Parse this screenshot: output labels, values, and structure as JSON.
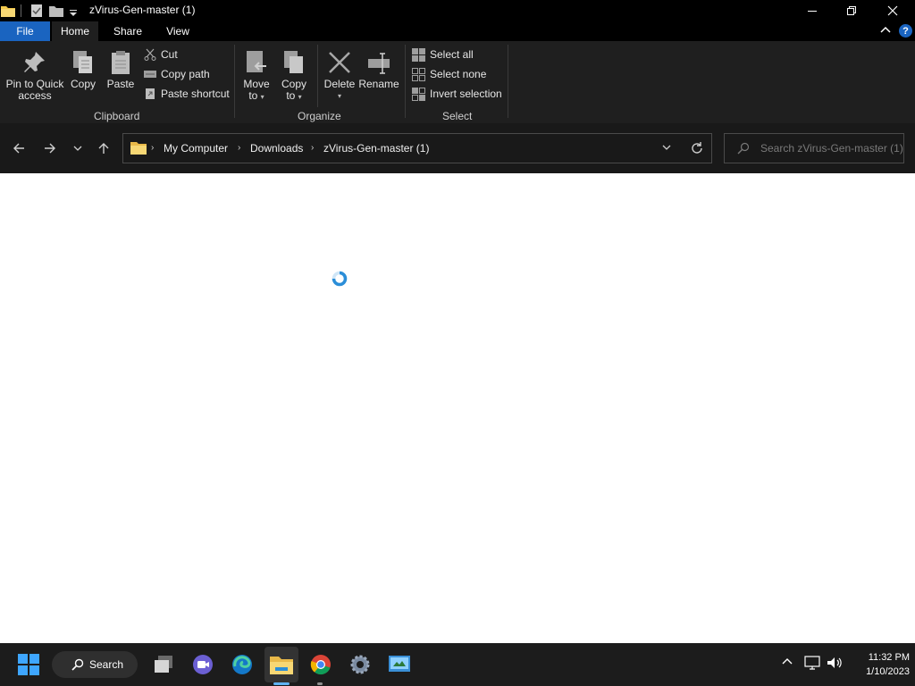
{
  "window": {
    "title": "zVirus-Gen-master (1)"
  },
  "ribbon": {
    "tabs": [
      {
        "label": "File",
        "active": false
      },
      {
        "label": "Home",
        "active": true
      },
      {
        "label": "Share",
        "active": false
      },
      {
        "label": "View",
        "active": false
      }
    ],
    "help_label": "?",
    "clipboard": {
      "pin_line1": "Pin to Quick",
      "pin_line2": "access",
      "copy": "Copy",
      "paste": "Paste",
      "cut": "Cut",
      "copy_path": "Copy path",
      "paste_shortcut": "Paste shortcut",
      "group_label": "Clipboard"
    },
    "organize": {
      "move_line1": "Move",
      "move_line2": "to",
      "copy_line1": "Copy",
      "copy_line2": "to",
      "delete": "Delete",
      "rename": "Rename",
      "group_label": "Organize"
    },
    "select": {
      "select_all": "Select all",
      "select_none": "Select none",
      "invert_selection": "Invert selection",
      "group_label": "Select"
    }
  },
  "address": {
    "breadcrumb": [
      "My Computer",
      "Downloads",
      "zVirus-Gen-master (1)"
    ]
  },
  "search": {
    "placeholder": "Search zVirus-Gen-master (1)"
  },
  "content": {
    "state": "loading"
  },
  "taskbar": {
    "search_label": "Search",
    "pinned": [
      "start-icon",
      "task-view-icon",
      "teams-chat-icon",
      "edge-icon",
      "file-explorer-icon",
      "chrome-icon",
      "settings-icon",
      "control-panel-icon"
    ],
    "clock_time": "11:32 PM",
    "clock_date": "1/10/2023"
  },
  "colors": {
    "accent": "#1a64c0",
    "ribbon_bg": "#1f1f1f",
    "titlebar_bg": "#000000",
    "taskbar_bg": "#1c1c1c"
  }
}
